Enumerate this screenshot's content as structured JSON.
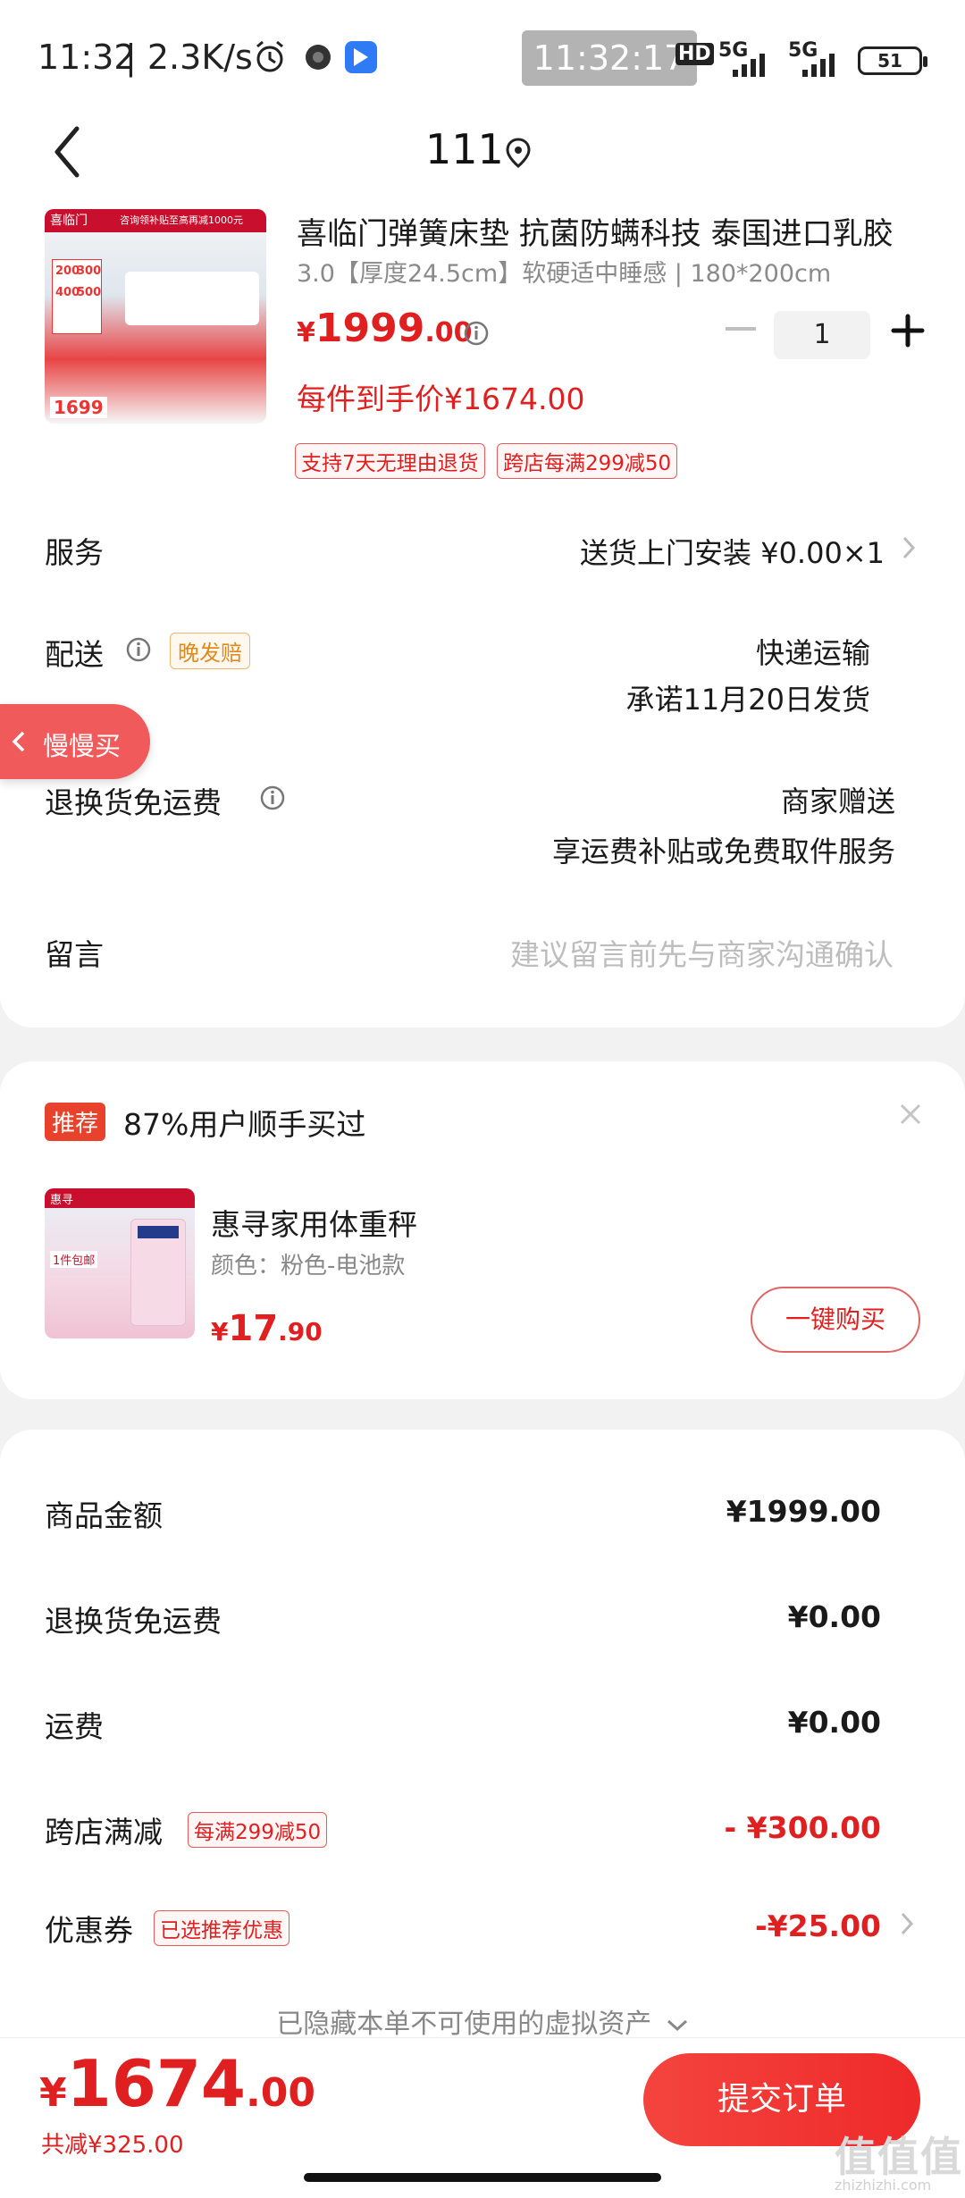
{
  "status_bar": {
    "time": "11:32",
    "speed": "| 2.3K/s",
    "clock_overlay": "11:32:17",
    "net_hd": "HD",
    "net1": "5G",
    "net2": "5G",
    "battery": "51"
  },
  "header": {
    "title": "111"
  },
  "product": {
    "title": "喜临门弹簧床垫 抗菌防螨科技 泰国进口乳胶",
    "spec": "3.0【厚度24.5cm】软硬适中睡感 | 180*200cm",
    "price_symbol": "¥",
    "price_int": "1999",
    "price_dec": ".00",
    "quantity": "1",
    "unit_price_label": "每件到手价¥1674.00",
    "tags": [
      "支持7天无理由退货",
      "跨店每满299减50"
    ],
    "image_texts": {
      "brand": "喜临门",
      "promo": "咨询领补贴至高再减1000元",
      "big_price": "1699",
      "discounts": [
        "200",
        "300",
        "400",
        "500"
      ]
    }
  },
  "rows": {
    "service": {
      "label": "服务",
      "value": "送货上门安装  ¥0.00×1"
    },
    "delivery": {
      "label": "配送",
      "tag": "晚发赔",
      "value1": "快递运输",
      "value2": "承诺11月20日发货"
    },
    "return": {
      "label": "退换货免运费",
      "value1": "商家赠送",
      "value2": "享运费补贴或免费取件服务"
    },
    "message": {
      "label": "留言",
      "placeholder": "建议留言前先与商家沟通确认"
    }
  },
  "float_button": {
    "label": "慢慢买"
  },
  "recommend": {
    "badge": "推荐",
    "text": "87%用户顺手买过",
    "item_name": "惠寻家用体重秤",
    "item_color": "颜色：粉色-电池款",
    "price_symbol": "¥",
    "price_int": "17",
    "price_dec": ".90",
    "buy_label": "一键购买",
    "image_texts": [
      "惠寻",
      "1件包邮"
    ]
  },
  "summary": {
    "items": [
      {
        "label": "商品金额",
        "value": "¥1999.00",
        "red": false
      },
      {
        "label": "退换货免运费",
        "value": "¥0.00",
        "red": false
      },
      {
        "label": "运费",
        "value": "¥0.00",
        "red": false
      },
      {
        "label": "跨店满减",
        "tag": "每满299减50",
        "value": "- ¥300.00",
        "red": true
      },
      {
        "label": "优惠券",
        "tag": "已选推荐优惠",
        "value": "-¥25.00",
        "red": true
      }
    ],
    "hidden_note": "已隐藏本单不可使用的虚拟资产"
  },
  "bottom": {
    "currency": "¥",
    "total_int": "1674",
    "total_dec": ".00",
    "saved": "共减¥325.00",
    "submit": "提交订单"
  },
  "watermark": {
    "main": "值值值",
    "sub": "zhizhizhi.com"
  },
  "colors": {
    "accent": "#e02020",
    "background": "#f2f2f2",
    "card": "#ffffff"
  }
}
